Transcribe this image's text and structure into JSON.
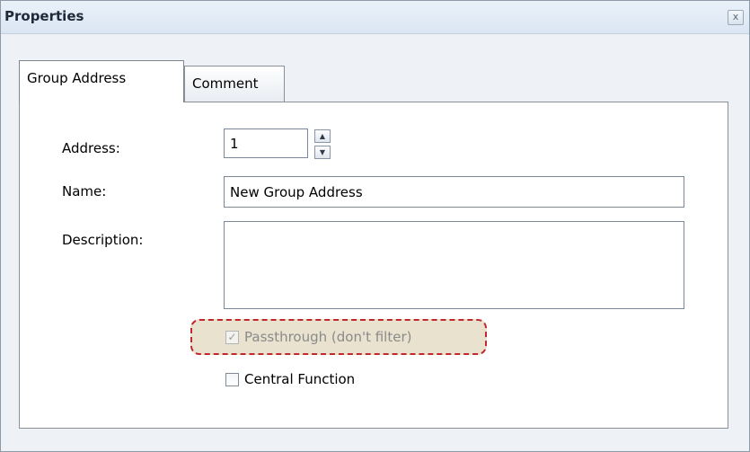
{
  "window": {
    "title": "Properties",
    "close_glyph": "x"
  },
  "tabs": [
    {
      "label": "Group Address",
      "active": true
    },
    {
      "label": "Comment",
      "active": false
    }
  ],
  "form": {
    "address_label": "Address:",
    "address_value": "1",
    "name_label": "Name:",
    "name_value": "New Group Address",
    "description_label": "Description:",
    "description_value": "",
    "passthrough_label": "Passthrough (don't filter)",
    "passthrough_checked": true,
    "passthrough_enabled": false,
    "central_function_label": "Central Function",
    "central_function_checked": false
  },
  "glyphs": {
    "spin_up": "▲",
    "spin_down": "▼",
    "check": "✓"
  },
  "colors": {
    "highlight_border": "#c0282e",
    "highlight_fill": "#e8e2cf"
  }
}
